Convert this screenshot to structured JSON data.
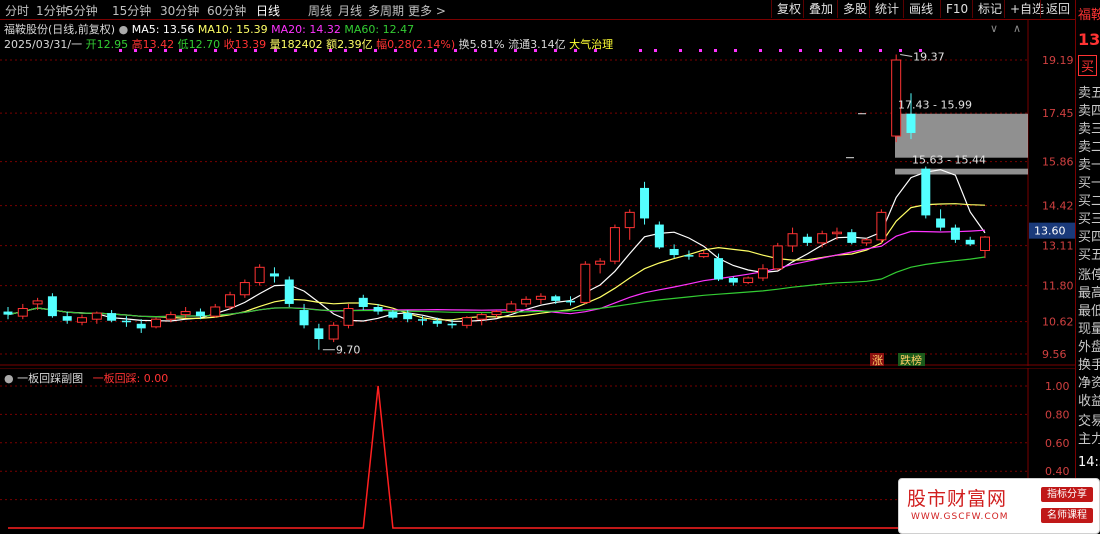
{
  "toolbar": {
    "tabs": [
      "分时",
      "1分钟",
      "5分钟",
      "15分钟",
      "30分钟",
      "60分钟",
      "日线",
      "周线",
      "月线",
      "多周期",
      "更多 >"
    ],
    "active_tab": "日线",
    "buttons": [
      "复权",
      "叠加",
      "多股",
      "统计",
      "画线",
      "F10",
      "标记",
      "+自选",
      "返回"
    ]
  },
  "info": {
    "stock_name": "福鞍股份(日线,前复权)",
    "ma5": "MA5: 13.56",
    "ma10": "MA10: 15.39",
    "ma20": "MA20: 14.32",
    "ma60": "MA60: 12.47",
    "date": "2025/03/31/一",
    "open": "开12.95",
    "high": "高13.42",
    "low": "低12.70",
    "close": "收13.39",
    "volume": "量182402",
    "amount": "额2.39亿",
    "change": "幅0.28(2.14%)",
    "turnover": "换5.81%",
    "float_cap": "流通3.14亿",
    "concept": "大气治理"
  },
  "price_axis": [
    "19.19",
    "17.45",
    "15.86",
    "14.42",
    "13.11",
    "11.80",
    "10.62",
    "9.56"
  ],
  "current_price_tag": "13.60",
  "annotations": {
    "high_mark": "19.37",
    "low_mark": "9.70",
    "box_upper": "17.43 - 15.99",
    "box_lower": "15.63 - 15.44",
    "tag_zhang": "涨",
    "tag_dieban": "跌榜"
  },
  "sub_chart": {
    "title": "一板回踩副图",
    "indicator": "一板回踩: 0.00",
    "axis": [
      "1.00",
      "0.80",
      "0.60",
      "0.40",
      "0.20"
    ]
  },
  "right_panel": {
    "items": [
      "福鞍",
      "13",
      "买",
      "卖五",
      "卖四",
      "卖三",
      "卖二",
      "卖一",
      "买一",
      "买二",
      "买三",
      "买四",
      "买五",
      "涨停",
      "最高",
      "最低",
      "现量",
      "外盘",
      "换手",
      "净资",
      "收益",
      "交易",
      "主力",
      "14:5"
    ]
  },
  "watermark": {
    "title": "股市财富网",
    "url": "WWW.GSCFW.COM",
    "badge1": "指标分享",
    "badge2": "名师课程"
  },
  "colors": {
    "up": "#ff3333",
    "down": "#54ffff",
    "ma5": "#ffffff",
    "ma10": "#ffff66",
    "ma20": "#ff33ff",
    "ma60": "#33cc33",
    "grid": "#7a0000"
  },
  "chart_data": {
    "type": "candlestick",
    "candles": [
      {
        "o": 10.95,
        "h": 11.1,
        "l": 10.7,
        "c": 10.85
      },
      {
        "o": 10.8,
        "h": 11.2,
        "l": 10.7,
        "c": 11.05
      },
      {
        "o": 11.2,
        "h": 11.4,
        "l": 11.0,
        "c": 11.3
      },
      {
        "o": 11.45,
        "h": 11.55,
        "l": 10.75,
        "c": 10.8
      },
      {
        "o": 10.8,
        "h": 10.95,
        "l": 10.55,
        "c": 10.65
      },
      {
        "o": 10.6,
        "h": 10.85,
        "l": 10.5,
        "c": 10.75
      },
      {
        "o": 10.7,
        "h": 10.95,
        "l": 10.55,
        "c": 10.9
      },
      {
        "o": 10.9,
        "h": 11.0,
        "l": 10.6,
        "c": 10.65
      },
      {
        "o": 10.65,
        "h": 10.8,
        "l": 10.45,
        "c": 10.6
      },
      {
        "o": 10.55,
        "h": 10.7,
        "l": 10.25,
        "c": 10.4
      },
      {
        "o": 10.45,
        "h": 10.75,
        "l": 10.4,
        "c": 10.7
      },
      {
        "o": 10.7,
        "h": 10.95,
        "l": 10.6,
        "c": 10.85
      },
      {
        "o": 10.85,
        "h": 11.1,
        "l": 10.75,
        "c": 10.95
      },
      {
        "o": 10.95,
        "h": 11.05,
        "l": 10.7,
        "c": 10.8
      },
      {
        "o": 10.8,
        "h": 11.2,
        "l": 10.75,
        "c": 11.1
      },
      {
        "o": 11.1,
        "h": 11.6,
        "l": 11.0,
        "c": 11.5
      },
      {
        "o": 11.5,
        "h": 12.0,
        "l": 11.4,
        "c": 11.9
      },
      {
        "o": 11.9,
        "h": 12.5,
        "l": 11.8,
        "c": 12.4
      },
      {
        "o": 12.2,
        "h": 12.4,
        "l": 11.9,
        "c": 12.1
      },
      {
        "o": 12.0,
        "h": 12.1,
        "l": 11.1,
        "c": 11.2
      },
      {
        "o": 11.0,
        "h": 11.2,
        "l": 10.4,
        "c": 10.5
      },
      {
        "o": 10.4,
        "h": 10.55,
        "l": 9.7,
        "c": 10.05
      },
      {
        "o": 10.05,
        "h": 10.6,
        "l": 9.95,
        "c": 10.5
      },
      {
        "o": 10.5,
        "h": 11.2,
        "l": 10.4,
        "c": 11.05
      },
      {
        "o": 11.4,
        "h": 11.5,
        "l": 11.0,
        "c": 11.1
      },
      {
        "o": 11.1,
        "h": 11.2,
        "l": 10.85,
        "c": 10.95
      },
      {
        "o": 10.95,
        "h": 11.0,
        "l": 10.7,
        "c": 10.75
      },
      {
        "o": 10.9,
        "h": 11.0,
        "l": 10.6,
        "c": 10.7
      },
      {
        "o": 10.7,
        "h": 10.8,
        "l": 10.5,
        "c": 10.65
      },
      {
        "o": 10.65,
        "h": 10.75,
        "l": 10.45,
        "c": 10.55
      },
      {
        "o": 10.55,
        "h": 10.7,
        "l": 10.4,
        "c": 10.5
      },
      {
        "o": 10.5,
        "h": 10.8,
        "l": 10.4,
        "c": 10.75
      },
      {
        "o": 10.7,
        "h": 10.9,
        "l": 10.5,
        "c": 10.85
      },
      {
        "o": 10.85,
        "h": 11.0,
        "l": 10.75,
        "c": 10.95
      },
      {
        "o": 10.95,
        "h": 11.3,
        "l": 10.9,
        "c": 11.2
      },
      {
        "o": 11.2,
        "h": 11.45,
        "l": 11.1,
        "c": 11.35
      },
      {
        "o": 11.35,
        "h": 11.55,
        "l": 11.2,
        "c": 11.45
      },
      {
        "o": 11.45,
        "h": 11.5,
        "l": 11.2,
        "c": 11.3
      },
      {
        "o": 11.3,
        "h": 11.45,
        "l": 11.15,
        "c": 11.25
      },
      {
        "o": 11.25,
        "h": 12.6,
        "l": 11.2,
        "c": 12.5
      },
      {
        "o": 12.5,
        "h": 12.7,
        "l": 12.2,
        "c": 12.6
      },
      {
        "o": 12.6,
        "h": 13.8,
        "l": 12.5,
        "c": 13.7
      },
      {
        "o": 13.7,
        "h": 14.3,
        "l": 13.3,
        "c": 14.2
      },
      {
        "o": 15.0,
        "h": 15.2,
        "l": 13.8,
        "c": 14.0
      },
      {
        "o": 13.8,
        "h": 13.9,
        "l": 13.0,
        "c": 13.05
      },
      {
        "o": 13.0,
        "h": 13.15,
        "l": 12.7,
        "c": 12.8
      },
      {
        "o": 12.8,
        "h": 12.95,
        "l": 12.65,
        "c": 12.75
      },
      {
        "o": 12.75,
        "h": 12.95,
        "l": 12.7,
        "c": 12.85
      },
      {
        "o": 12.7,
        "h": 12.85,
        "l": 11.95,
        "c": 12.0
      },
      {
        "o": 12.05,
        "h": 12.1,
        "l": 11.8,
        "c": 11.9
      },
      {
        "o": 11.9,
        "h": 12.1,
        "l": 11.85,
        "c": 12.05
      },
      {
        "o": 12.05,
        "h": 12.5,
        "l": 11.95,
        "c": 12.35
      },
      {
        "o": 12.35,
        "h": 13.2,
        "l": 12.3,
        "c": 13.1
      },
      {
        "o": 13.1,
        "h": 13.7,
        "l": 12.9,
        "c": 13.5
      },
      {
        "o": 13.4,
        "h": 13.5,
        "l": 13.1,
        "c": 13.2
      },
      {
        "o": 13.2,
        "h": 13.6,
        "l": 13.05,
        "c": 13.5
      },
      {
        "o": 13.5,
        "h": 13.7,
        "l": 13.3,
        "c": 13.55
      },
      {
        "o": 13.55,
        "h": 13.65,
        "l": 13.15,
        "c": 13.2
      },
      {
        "o": 13.2,
        "h": 13.35,
        "l": 13.1,
        "c": 13.3
      },
      {
        "o": 13.3,
        "h": 14.3,
        "l": 13.2,
        "c": 14.2
      },
      {
        "o": 16.7,
        "h": 19.37,
        "l": 16.5,
        "c": 19.19
      },
      {
        "o": 17.43,
        "h": 18.1,
        "l": 16.6,
        "c": 16.8
      },
      {
        "o": 15.63,
        "h": 15.7,
        "l": 14.0,
        "c": 14.1
      },
      {
        "o": 14.0,
        "h": 14.3,
        "l": 13.6,
        "c": 13.7
      },
      {
        "o": 13.7,
        "h": 13.8,
        "l": 13.2,
        "c": 13.3
      },
      {
        "o": 13.3,
        "h": 13.4,
        "l": 13.1,
        "c": 13.15
      },
      {
        "o": 12.95,
        "h": 13.42,
        "l": 12.7,
        "c": 13.39
      }
    ],
    "ylim": [
      9.56,
      19.19
    ],
    "sub_series": {
      "name": "一板回踩",
      "values": [
        0,
        0,
        0,
        0,
        0,
        0,
        0,
        0,
        0,
        0,
        0,
        0,
        0,
        0,
        0,
        0,
        0,
        0,
        0,
        0,
        0,
        0,
        0,
        0,
        0,
        1,
        0,
        0,
        0,
        0,
        0,
        0,
        0,
        0,
        0,
        0,
        0,
        0,
        0,
        0,
        0,
        0,
        0,
        0,
        0,
        0,
        0,
        0,
        0,
        0,
        0,
        0,
        0,
        0,
        0,
        0,
        0,
        0,
        0,
        0,
        0,
        0,
        0,
        0,
        0,
        0,
        0
      ],
      "ylim": [
        0,
        1
      ]
    }
  }
}
